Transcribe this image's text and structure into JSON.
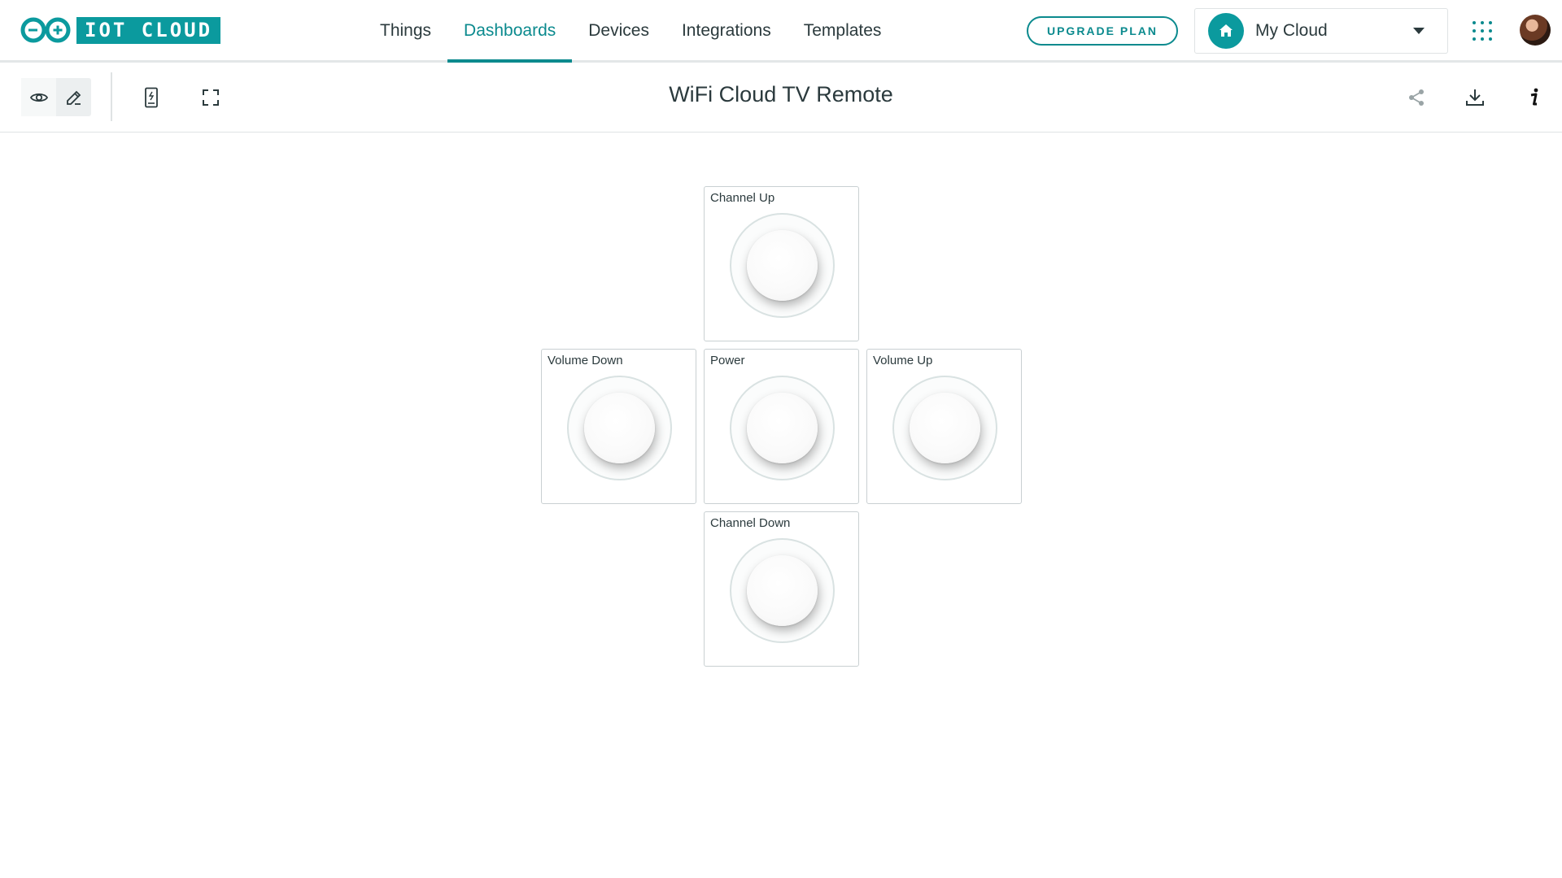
{
  "app": {
    "logo_text": "IOT CLOUD"
  },
  "nav": {
    "items": [
      {
        "label": "Things"
      },
      {
        "label": "Dashboards"
      },
      {
        "label": "Devices"
      },
      {
        "label": "Integrations"
      },
      {
        "label": "Templates"
      }
    ],
    "active": "Dashboards"
  },
  "header": {
    "upgrade_label": "UPGRADE PLAN",
    "space_label": "My Cloud"
  },
  "toolbar": {
    "title": "WiFi Cloud TV Remote",
    "mode_active": "view"
  },
  "widgets": [
    {
      "title": "Channel Up",
      "type": "push-button"
    },
    {
      "title": "Volume Down",
      "type": "push-button"
    },
    {
      "title": "Power",
      "type": "push-button"
    },
    {
      "title": "Volume Up",
      "type": "push-button"
    },
    {
      "title": "Channel Down",
      "type": "push-button"
    }
  ],
  "colors": {
    "accent": "#0b8a8e",
    "brand": "#0b9a9e",
    "border": "#c9d0d2"
  }
}
